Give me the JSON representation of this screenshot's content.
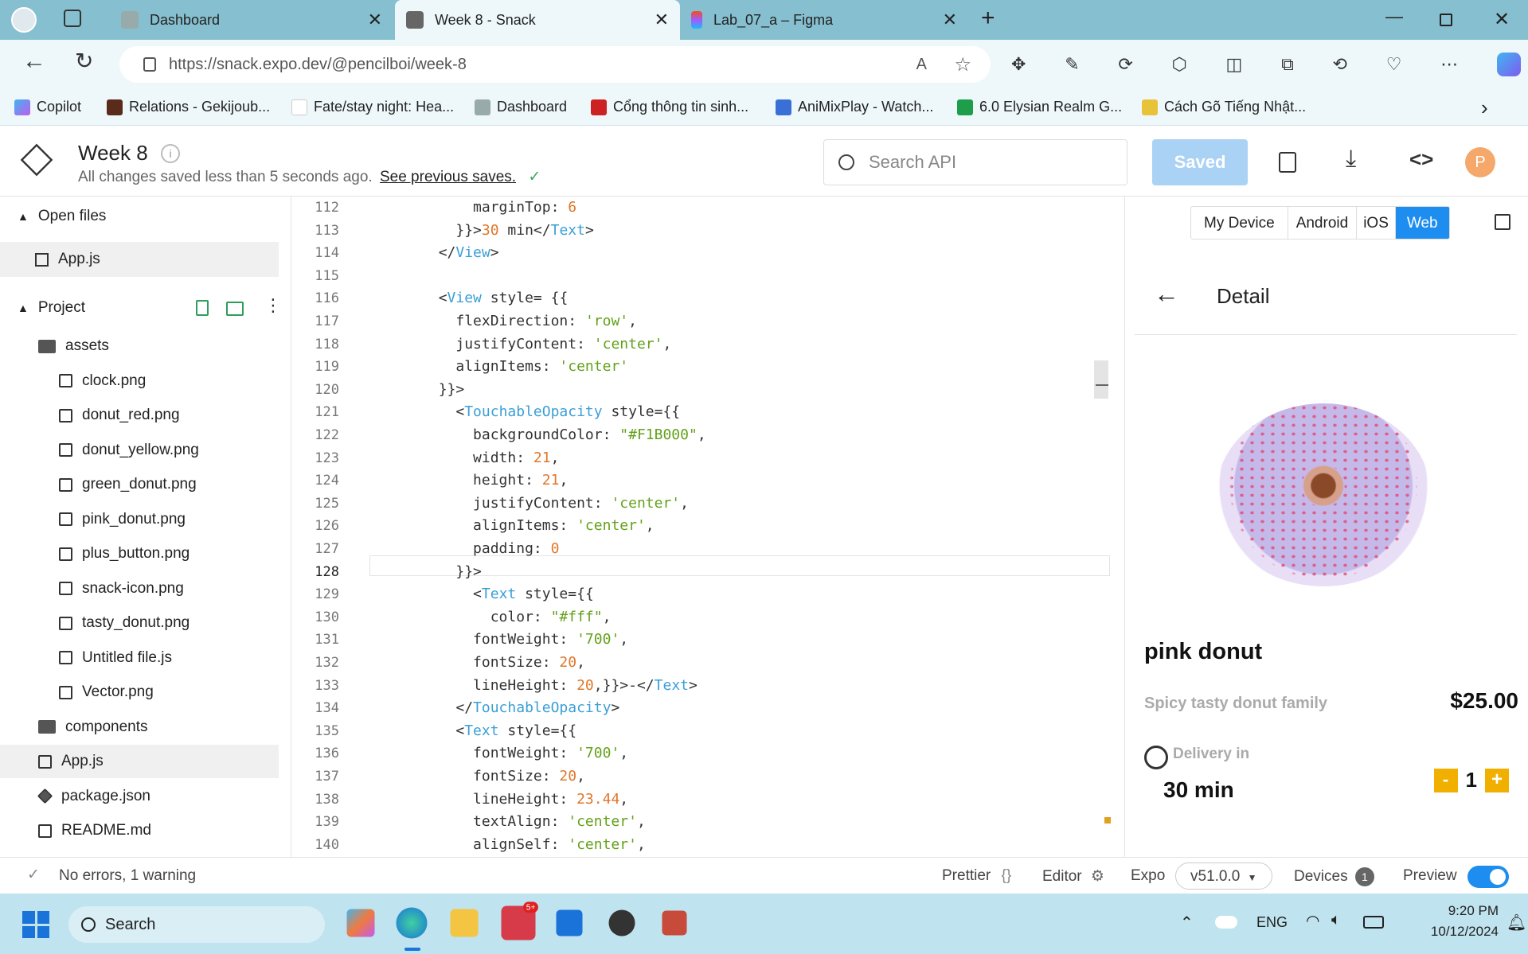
{
  "browser": {
    "tabs": [
      {
        "title": "Dashboard",
        "active": false
      },
      {
        "title": "Week 8 - Snack",
        "active": true
      },
      {
        "title": "Lab_07_a – Figma",
        "active": false
      }
    ],
    "url": "https://snack.expo.dev/@pencilboi/week-8",
    "bookmarks": [
      "Copilot",
      "Relations - Gekijoub...",
      "Fate/stay night: Hea...",
      "Dashboard",
      "Cổng thông tin sinh...",
      "AniMixPlay - Watch...",
      "6.0 Elysian Realm G...",
      "Cách Gõ Tiếng Nhật..."
    ]
  },
  "snack": {
    "project_title": "Week 8",
    "save_status": "All changes saved less than 5 seconds ago.",
    "previous_saves": "See previous saves.",
    "search_placeholder": "Search API",
    "saved_button": "Saved",
    "avatar_initial": "P"
  },
  "sidebar": {
    "open_files_label": "Open files",
    "open_files": [
      "App.js"
    ],
    "project_label": "Project",
    "tree": [
      {
        "name": "assets",
        "kind": "folder",
        "indent": 0
      },
      {
        "name": "clock.png",
        "kind": "image",
        "indent": 1
      },
      {
        "name": "donut_red.png",
        "kind": "image",
        "indent": 1
      },
      {
        "name": "donut_yellow.png",
        "kind": "image",
        "indent": 1
      },
      {
        "name": "green_donut.png",
        "kind": "image",
        "indent": 1
      },
      {
        "name": "pink_donut.png",
        "kind": "image",
        "indent": 1
      },
      {
        "name": "plus_button.png",
        "kind": "image",
        "indent": 1
      },
      {
        "name": "snack-icon.png",
        "kind": "image",
        "indent": 1
      },
      {
        "name": "tasty_donut.png",
        "kind": "image",
        "indent": 1
      },
      {
        "name": "Untitled file.js",
        "kind": "file",
        "indent": 1
      },
      {
        "name": "Vector.png",
        "kind": "image",
        "indent": 1
      },
      {
        "name": "components",
        "kind": "folder",
        "indent": 0
      },
      {
        "name": "App.js",
        "kind": "js",
        "indent": 0,
        "selected": true
      },
      {
        "name": "package.json",
        "kind": "pkg",
        "indent": 0
      },
      {
        "name": "README.md",
        "kind": "file",
        "indent": 0
      }
    ]
  },
  "editor": {
    "current_line": 128,
    "lines": [
      {
        "n": 112,
        "html": "            marginTop: <span class=\"num\">6</span>"
      },
      {
        "n": 113,
        "html": "          }}><span class=\"num\">30</span> min&lt;/<span class=\"tag\">Text</span>&gt;"
      },
      {
        "n": 114,
        "html": "        &lt;/<span class=\"tag\">View</span>&gt;"
      },
      {
        "n": 115,
        "html": ""
      },
      {
        "n": 116,
        "html": "        &lt;<span class=\"tag\">View</span> style= {{"
      },
      {
        "n": 117,
        "html": "          flexDirection: <span class=\"str\">'row'</span>,"
      },
      {
        "n": 118,
        "html": "          justifyContent: <span class=\"str\">'center'</span>,"
      },
      {
        "n": 119,
        "html": "          alignItems: <span class=\"str\">'center'</span>"
      },
      {
        "n": 120,
        "html": "        }}>"
      },
      {
        "n": 121,
        "html": "          &lt;<span class=\"tag\">TouchableOpacity</span> style={{"
      },
      {
        "n": 122,
        "html": "            backgroundColor: <span class=\"str\">\"#F1B000\"</span>,"
      },
      {
        "n": 123,
        "html": "            width: <span class=\"num\">21</span>,"
      },
      {
        "n": 124,
        "html": "            height: <span class=\"num\">21</span>,"
      },
      {
        "n": 125,
        "html": "            justifyContent: <span class=\"str\">'center'</span>,"
      },
      {
        "n": 126,
        "html": "            alignItems: <span class=\"str\">'center'</span>,"
      },
      {
        "n": 127,
        "html": "            padding: <span class=\"num\">0</span>"
      },
      {
        "n": 128,
        "html": "          }}>"
      },
      {
        "n": 129,
        "html": "            &lt;<span class=\"tag\">Text</span> style={{"
      },
      {
        "n": 130,
        "html": "              color: <span class=\"str\">\"#fff\"</span>,"
      },
      {
        "n": 131,
        "html": "            fontWeight: <span class=\"str\">'700'</span>,"
      },
      {
        "n": 132,
        "html": "            fontSize: <span class=\"num\">20</span>,"
      },
      {
        "n": 133,
        "html": "            lineHeight: <span class=\"num\">20</span>,}}>-&lt;/<span class=\"tag\">Text</span>&gt;"
      },
      {
        "n": 134,
        "html": "          &lt;/<span class=\"tag\">TouchableOpacity</span>&gt;"
      },
      {
        "n": 135,
        "html": "          &lt;<span class=\"tag\">Text</span> style={{"
      },
      {
        "n": 136,
        "html": "            fontWeight: <span class=\"str\">'700'</span>,"
      },
      {
        "n": 137,
        "html": "            fontSize: <span class=\"num\">20</span>,"
      },
      {
        "n": 138,
        "html": "            lineHeight: <span class=\"num\">23.44</span>,"
      },
      {
        "n": 139,
        "html": "            textAlign: <span class=\"str\">'center'</span>,"
      },
      {
        "n": 140,
        "html": "            alignSelf: <span class=\"str\">'center'</span>,"
      }
    ]
  },
  "preview": {
    "platforms": [
      "My Device",
      "Android",
      "iOS",
      "Web"
    ],
    "selected_platform": "Web",
    "screen_title": "Detail",
    "product_name": "pink donut",
    "product_desc": "Spicy tasty donut family",
    "price": "$25.00",
    "delivery_label": "Delivery in",
    "delivery_time": "30 min",
    "quantity": "1",
    "minus": "-",
    "plus": "+",
    "accent": "#F1B000"
  },
  "status": {
    "problems": "No errors, 1 warning",
    "prettier": "Prettier",
    "editor": "Editor",
    "expo": "Expo",
    "sdk": "v51.0.0",
    "devices": "Devices",
    "devices_count": "1",
    "preview": "Preview"
  },
  "taskbar": {
    "search": "Search",
    "lang": "ENG",
    "time": "9:20 PM",
    "date": "10/12/2024",
    "zalo_badge": "5+"
  }
}
